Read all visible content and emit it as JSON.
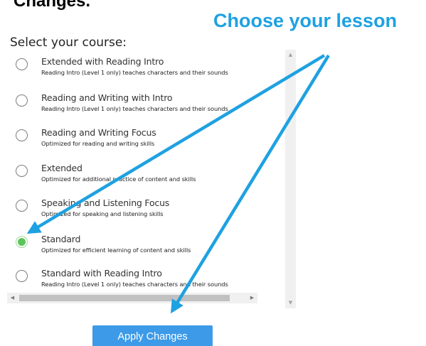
{
  "header": {
    "cut_text": "Changes.",
    "callout": "Choose your lesson"
  },
  "course_select": {
    "title": "Select your course:",
    "selected_index": 5,
    "options": [
      {
        "label": "Extended with Reading Intro",
        "desc": "Reading Intro (Level 1 only) teaches characters and their sounds"
      },
      {
        "label": "Reading and Writing with Intro",
        "desc": "Reading Intro (Level 1 only) teaches characters and their sounds"
      },
      {
        "label": "Reading and Writing Focus",
        "desc": "Optimized for reading and writing skills"
      },
      {
        "label": "Extended",
        "desc": "Optimized for additional practice of content and skills"
      },
      {
        "label": "Speaking and Listening Focus",
        "desc": "Optimized for speaking and listening skills"
      },
      {
        "label": "Standard",
        "desc": "Optimized for efficient learning of content and skills"
      },
      {
        "label": "Standard with Reading Intro",
        "desc": "Reading Intro (Level 1 only) teaches characters and their sounds"
      }
    ]
  },
  "actions": {
    "apply_label": "Apply Changes"
  },
  "colors": {
    "accent": "#1ea1e1",
    "button": "#3c9ae8",
    "radio_checked": "#5cc45a"
  }
}
